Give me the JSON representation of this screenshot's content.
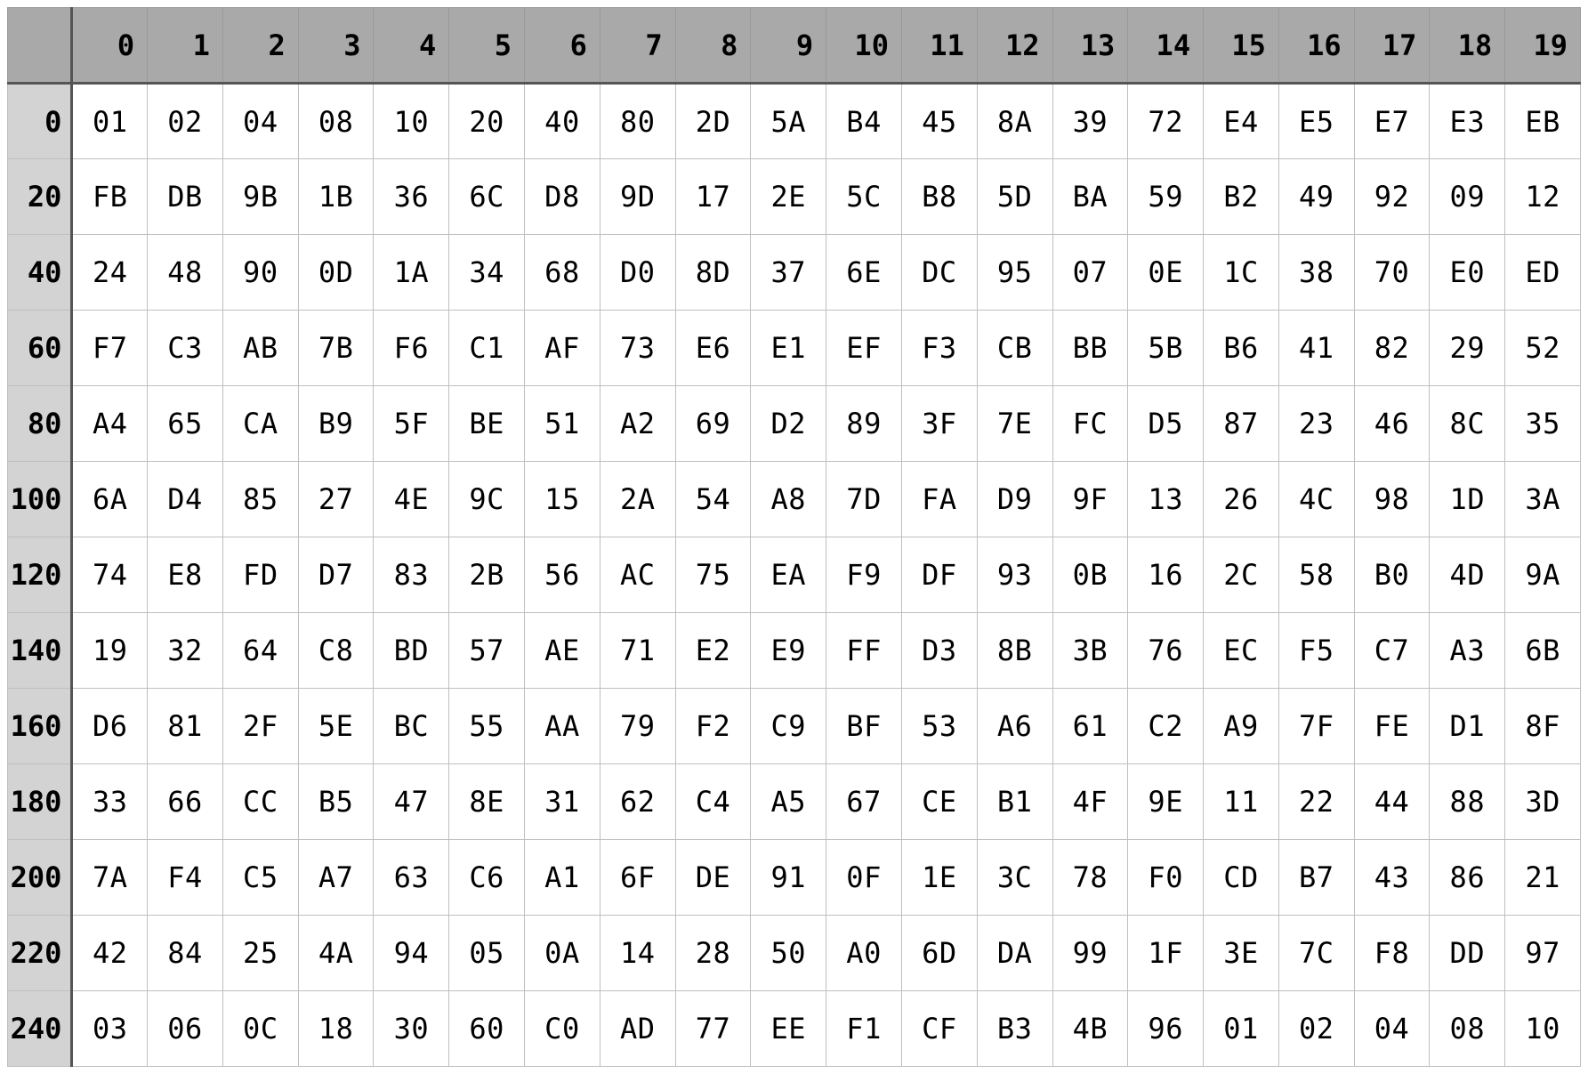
{
  "columns": [
    "0",
    "1",
    "2",
    "3",
    "4",
    "5",
    "6",
    "7",
    "8",
    "9",
    "10",
    "11",
    "12",
    "13",
    "14",
    "15",
    "16",
    "17",
    "18",
    "19"
  ],
  "row_labels": [
    "0",
    "20",
    "40",
    "60",
    "80",
    "100",
    "120",
    "140",
    "160",
    "180",
    "200",
    "220",
    "240"
  ],
  "rows": [
    [
      "01",
      "02",
      "04",
      "08",
      "10",
      "20",
      "40",
      "80",
      "2D",
      "5A",
      "B4",
      "45",
      "8A",
      "39",
      "72",
      "E4",
      "E5",
      "E7",
      "E3",
      "EB"
    ],
    [
      "FB",
      "DB",
      "9B",
      "1B",
      "36",
      "6C",
      "D8",
      "9D",
      "17",
      "2E",
      "5C",
      "B8",
      "5D",
      "BA",
      "59",
      "B2",
      "49",
      "92",
      "09",
      "12"
    ],
    [
      "24",
      "48",
      "90",
      "0D",
      "1A",
      "34",
      "68",
      "D0",
      "8D",
      "37",
      "6E",
      "DC",
      "95",
      "07",
      "0E",
      "1C",
      "38",
      "70",
      "E0",
      "ED"
    ],
    [
      "F7",
      "C3",
      "AB",
      "7B",
      "F6",
      "C1",
      "AF",
      "73",
      "E6",
      "E1",
      "EF",
      "F3",
      "CB",
      "BB",
      "5B",
      "B6",
      "41",
      "82",
      "29",
      "52"
    ],
    [
      "A4",
      "65",
      "CA",
      "B9",
      "5F",
      "BE",
      "51",
      "A2",
      "69",
      "D2",
      "89",
      "3F",
      "7E",
      "FC",
      "D5",
      "87",
      "23",
      "46",
      "8C",
      "35"
    ],
    [
      "6A",
      "D4",
      "85",
      "27",
      "4E",
      "9C",
      "15",
      "2A",
      "54",
      "A8",
      "7D",
      "FA",
      "D9",
      "9F",
      "13",
      "26",
      "4C",
      "98",
      "1D",
      "3A"
    ],
    [
      "74",
      "E8",
      "FD",
      "D7",
      "83",
      "2B",
      "56",
      "AC",
      "75",
      "EA",
      "F9",
      "DF",
      "93",
      "0B",
      "16",
      "2C",
      "58",
      "B0",
      "4D",
      "9A"
    ],
    [
      "19",
      "32",
      "64",
      "C8",
      "BD",
      "57",
      "AE",
      "71",
      "E2",
      "E9",
      "FF",
      "D3",
      "8B",
      "3B",
      "76",
      "EC",
      "F5",
      "C7",
      "A3",
      "6B"
    ],
    [
      "D6",
      "81",
      "2F",
      "5E",
      "BC",
      "55",
      "AA",
      "79",
      "F2",
      "C9",
      "BF",
      "53",
      "A6",
      "61",
      "C2",
      "A9",
      "7F",
      "FE",
      "D1",
      "8F"
    ],
    [
      "33",
      "66",
      "CC",
      "B5",
      "47",
      "8E",
      "31",
      "62",
      "C4",
      "A5",
      "67",
      "CE",
      "B1",
      "4F",
      "9E",
      "11",
      "22",
      "44",
      "88",
      "3D"
    ],
    [
      "7A",
      "F4",
      "C5",
      "A7",
      "63",
      "C6",
      "A1",
      "6F",
      "DE",
      "91",
      "0F",
      "1E",
      "3C",
      "78",
      "F0",
      "CD",
      "B7",
      "43",
      "86",
      "21"
    ],
    [
      "42",
      "84",
      "25",
      "4A",
      "94",
      "05",
      "0A",
      "14",
      "28",
      "50",
      "A0",
      "6D",
      "DA",
      "99",
      "1F",
      "3E",
      "7C",
      "F8",
      "DD",
      "97"
    ],
    [
      "03",
      "06",
      "0C",
      "18",
      "30",
      "60",
      "C0",
      "AD",
      "77",
      "EE",
      "F1",
      "CF",
      "B3",
      "4B",
      "96",
      "01",
      "02",
      "04",
      "08",
      "10"
    ]
  ]
}
